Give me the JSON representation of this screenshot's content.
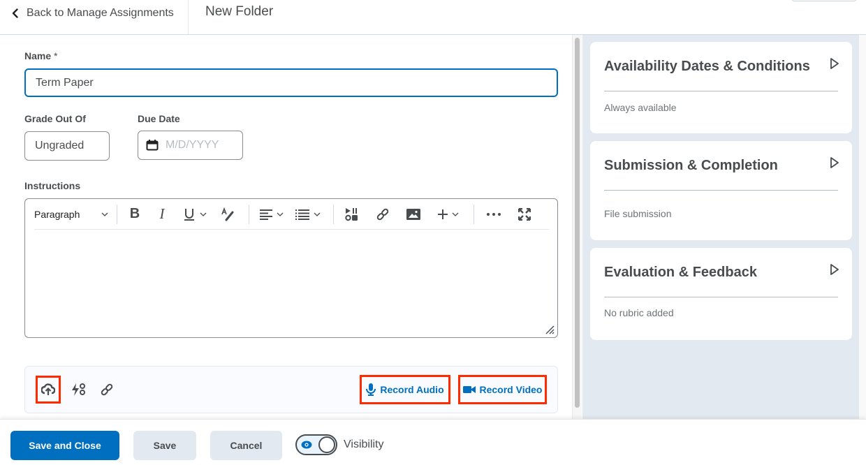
{
  "header": {
    "back_label": "Back to Manage Assignments",
    "title": "New Folder"
  },
  "form": {
    "name_label": "Name",
    "name_required_mark": "*",
    "name_value": "Term Paper",
    "grade_label": "Grade Out Of",
    "grade_value": "Ungraded",
    "due_label": "Due Date",
    "due_placeholder": "M/D/YYYY",
    "instructions_label": "Instructions"
  },
  "editor_toolbar": {
    "block_format": "Paragraph",
    "items": [
      "bold-icon",
      "italic-icon",
      "underline-icon",
      "text-style-icon",
      "align-icon",
      "list-icon",
      "media-icon",
      "link-icon",
      "image-icon",
      "insert-plus-icon",
      "more-icon",
      "fullscreen-icon"
    ]
  },
  "attachments": {
    "upload_icon": "cloud-upload-icon",
    "quicklink_icon": "quicklink-icon",
    "link_icon": "link-icon",
    "record_audio_label": "Record Audio",
    "record_video_label": "Record Video"
  },
  "side_panel": {
    "cards": [
      {
        "title": "Availability Dates & Conditions",
        "summary": "Always available"
      },
      {
        "title": "Submission & Completion",
        "summary": "File submission"
      },
      {
        "title": "Evaluation & Feedback",
        "summary": "No rubric added"
      }
    ]
  },
  "footer": {
    "save_close_label": "Save and Close",
    "save_label": "Save",
    "cancel_label": "Cancel",
    "visibility_label": "Visibility",
    "visibility_on": true
  },
  "colors": {
    "accent": "#006fbf",
    "highlight": "#ff2a00",
    "panel_bg": "#e3e9f1",
    "text": "#494c4e"
  }
}
